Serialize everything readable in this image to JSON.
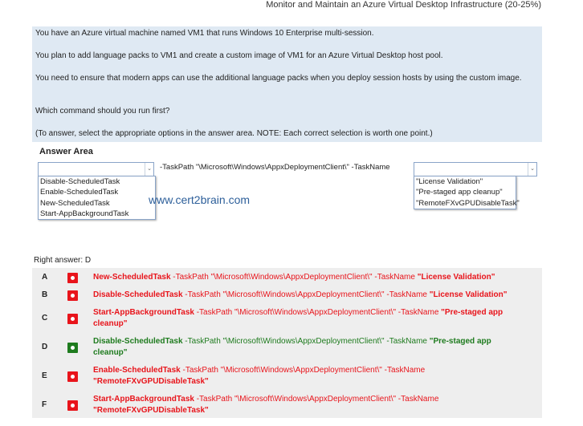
{
  "header": "Monitor and Maintain an Azure Virtual Desktop Infrastructure (20-25%)",
  "question": [
    "You have an Azure virtual machine named VM1 that runs Windows 10 Enterprise multi-session.",
    "You plan to add language packs to VM1 and create a custom image of VM1 for an Azure Virtual Desktop host pool.",
    "You need to ensure that modern apps can use the additional language packs when you deploy session hosts by using the custom image.",
    "Which command should you run first?",
    "(To answer, select the appropriate options in the answer area. NOTE: Each correct selection is worth one point.)"
  ],
  "answer_area": {
    "label": "Answer Area",
    "middle_text": "-TaskPath \"\\Microsoft\\Windows\\AppxDeploymentClient\\\" -TaskName",
    "dropdown1": [
      "Disable-ScheduledTask",
      "Enable-ScheduledTask",
      "New-ScheduledTask",
      "Start-AppBackgroundTask"
    ],
    "dropdown2": [
      "\"License Validation\"",
      "\"Pre-staged app cleanup\"",
      "\"RemoteFXvGPUDisableTask\""
    ],
    "watermark": "www.cert2brain.com"
  },
  "right_answer": "Right answer: D",
  "colors": {
    "wrong": "#e8141b",
    "correct": "#1e7b1e"
  },
  "options": [
    {
      "letter": "A",
      "cmd": "New-ScheduledTask",
      "mid": " -TaskPath \"\\Microsoft\\Windows\\AppxDeploymentClient\\\" -TaskName ",
      "task": "\"License Validation\"",
      "correct": false
    },
    {
      "letter": "B",
      "cmd": "Disable-ScheduledTask",
      "mid": " -TaskPath \"\\Microsoft\\Windows\\AppxDeploymentClient\\\" -TaskName ",
      "task": "\"License Validation\"",
      "correct": false
    },
    {
      "letter": "C",
      "cmd": "Start-AppBackgroundTask",
      "mid": " -TaskPath \"\\Microsoft\\Windows\\AppxDeploymentClient\\\" -TaskName ",
      "task": "\"Pre-staged app cleanup\"",
      "correct": false
    },
    {
      "letter": "D",
      "cmd": "Disable-ScheduledTask",
      "mid": " -TaskPath \"\\Microsoft\\Windows\\AppxDeploymentClient\\\" -TaskName ",
      "task": "\"Pre-staged app cleanup\"",
      "correct": true
    },
    {
      "letter": "E",
      "cmd": "Enable-ScheduledTask",
      "mid": " -TaskPath \"\\Microsoft\\Windows\\AppxDeploymentClient\\\" -TaskName ",
      "task": "\"RemoteFXvGPUDisableTask\"",
      "correct": false
    },
    {
      "letter": "F",
      "cmd": "Start-AppBackgroundTask",
      "mid": " -TaskPath \"\\Microsoft\\Windows\\AppxDeploymentClient\\\" -TaskName ",
      "task": "\"RemoteFXvGPUDisableTask\"",
      "correct": false
    }
  ]
}
